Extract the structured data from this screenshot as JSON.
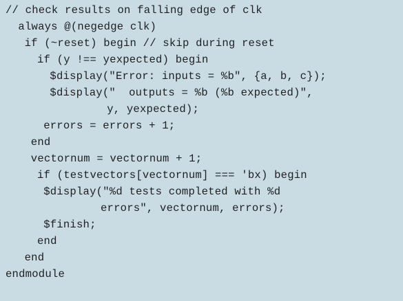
{
  "code": {
    "lines": [
      {
        "indent": 0,
        "text": "// check results on falling edge of clk"
      },
      {
        "indent": 2,
        "text": "always @(negedge clk)"
      },
      {
        "indent": 3,
        "text": "if (~reset) begin // skip during reset"
      },
      {
        "indent": 5,
        "text": "if (y !== yexpected) begin"
      },
      {
        "indent": 7,
        "text": "$display(\"Error: inputs = %b\", {a, b, c});"
      },
      {
        "indent": 7,
        "text": "$display(\"  outputs = %b (%b expected)\","
      },
      {
        "indent": 16,
        "text": "y, yexpected);"
      },
      {
        "indent": 6,
        "text": "errors = errors + 1;"
      },
      {
        "indent": 4,
        "text": "end"
      },
      {
        "indent": 4,
        "text": "vectornum = vectornum + 1;"
      },
      {
        "indent": 5,
        "text": "if (testvectors[vectornum] === 'bx) begin"
      },
      {
        "indent": 6,
        "text": "$display(\"%d tests completed with %d"
      },
      {
        "indent": 15,
        "text": "errors\", vectornum, errors);"
      },
      {
        "indent": 6,
        "text": "$finish;"
      },
      {
        "indent": 5,
        "text": "end"
      },
      {
        "indent": 3,
        "text": "end"
      },
      {
        "indent": 0,
        "text": "endmodule"
      }
    ]
  }
}
